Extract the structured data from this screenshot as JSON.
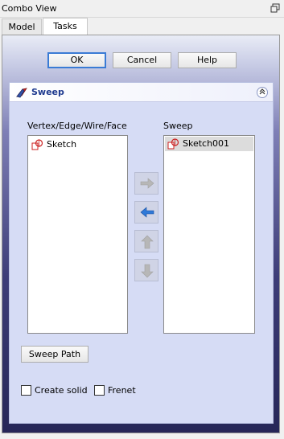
{
  "window": {
    "title": "Combo View",
    "float_icon": "float-window-icon"
  },
  "tabs": [
    {
      "label": "Model"
    },
    {
      "label": "Tasks"
    }
  ],
  "dialog_buttons": {
    "ok": "OK",
    "cancel": "Cancel",
    "help": "Help"
  },
  "task": {
    "title": "Sweep",
    "icon": "sweep-icon",
    "collapse_icon": "collapse-icon",
    "source_label": "Vertex/Edge/Wire/Face",
    "target_label": "Sweep",
    "source_items": [
      {
        "label": "Sketch"
      }
    ],
    "target_items": [
      {
        "label": "Sketch001",
        "selected": true
      }
    ],
    "move_buttons": [
      "arrow-right-icon",
      "arrow-left-icon",
      "arrow-up-icon",
      "arrow-down-icon"
    ],
    "sweep_path_label": "Sweep Path",
    "create_solid_label": "Create solid",
    "create_solid_checked": false,
    "frenet_label": "Frenet",
    "frenet_checked": false
  },
  "colors": {
    "accent": "#3a7bd5",
    "header_text": "#1e3a8f",
    "sketch_icon": "#cc2222"
  }
}
